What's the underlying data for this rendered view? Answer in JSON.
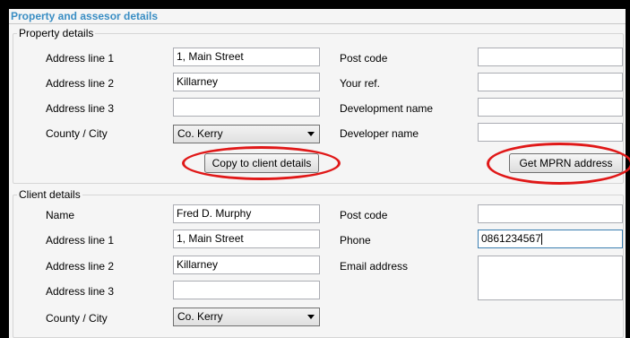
{
  "header": {
    "title": "Property and assesor details"
  },
  "property": {
    "legend": "Property details",
    "address1_label": "Address line 1",
    "address1_value": "1, Main Street",
    "address2_label": "Address line 2",
    "address2_value": "Killarney",
    "address3_label": "Address line 3",
    "address3_value": "",
    "county_label": "County / City",
    "county_value": "Co. Kerry",
    "postcode_label": "Post code",
    "postcode_value": "",
    "yourref_label": "Your ref.",
    "yourref_value": "",
    "devname_label": "Development name",
    "devname_value": "",
    "developer_label": "Developer name",
    "developer_value": "",
    "copy_button": "Copy to client details",
    "mprn_button": "Get MPRN address"
  },
  "client": {
    "legend": "Client details",
    "name_label": "Name",
    "name_value": "Fred D. Murphy",
    "address1_label": "Address line 1",
    "address1_value": "1, Main Street",
    "address2_label": "Address line 2",
    "address2_value": "Killarney",
    "address3_label": "Address line 3",
    "address3_value": "",
    "county_label": "County / City",
    "county_value": "Co. Kerry",
    "postcode_label": "Post code",
    "postcode_value": "",
    "phone_label": "Phone",
    "phone_value": "0861234567",
    "email_label": "Email address",
    "email_value": ""
  },
  "colors": {
    "title": "#3a8ec4",
    "highlight": "#e01818"
  }
}
